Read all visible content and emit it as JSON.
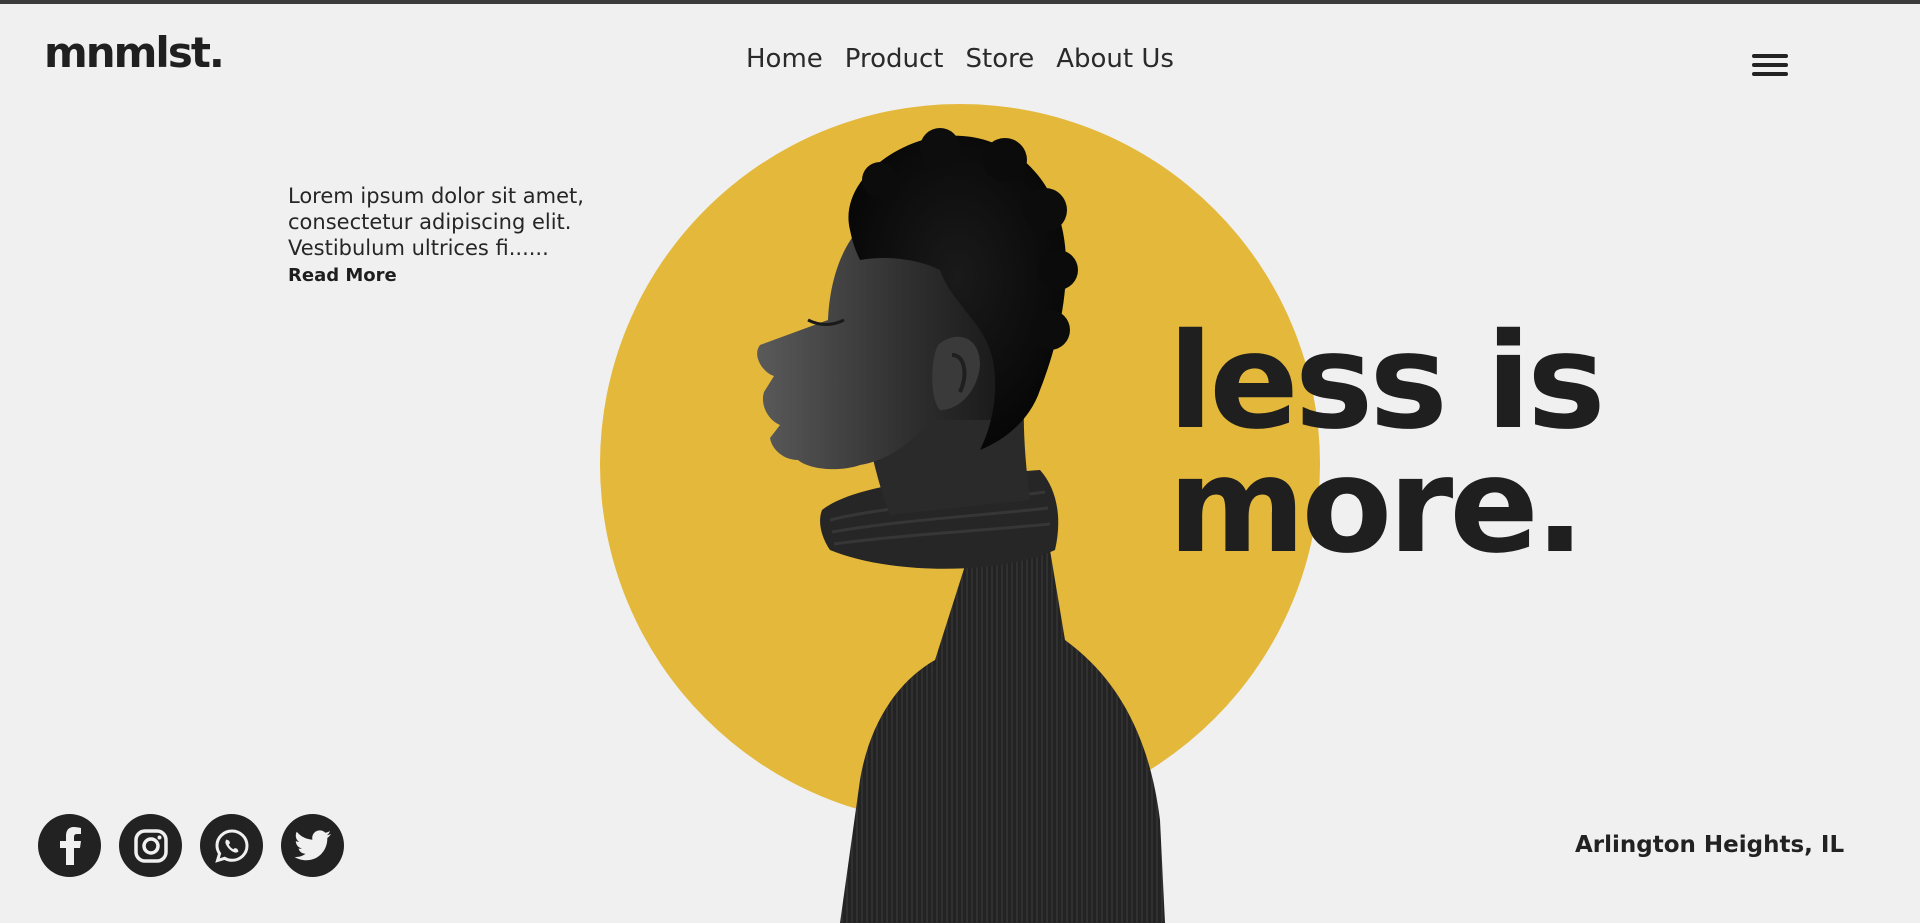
{
  "brand": {
    "logo": "mnmlst."
  },
  "nav": {
    "items": [
      "Home",
      "Product",
      "Store",
      "About Us"
    ]
  },
  "header": {
    "menu_icon": "hamburger-icon"
  },
  "intro": {
    "lines": [
      "Lorem ipsum dolor sit amet,",
      "consectetur adipiscing elit.",
      "Vestibulum ultrices fi......"
    ],
    "read_more": "Read More"
  },
  "hero": {
    "headline": [
      "less is",
      "more."
    ],
    "accent_color": "#e4b83b",
    "background_color": "#f0f0f0",
    "image": "grayscale-profile-portrait"
  },
  "socials": {
    "items": [
      "facebook-icon",
      "instagram-icon",
      "whatsapp-icon",
      "twitter-icon"
    ]
  },
  "footer": {
    "location": "Arlington Heights, IL"
  }
}
